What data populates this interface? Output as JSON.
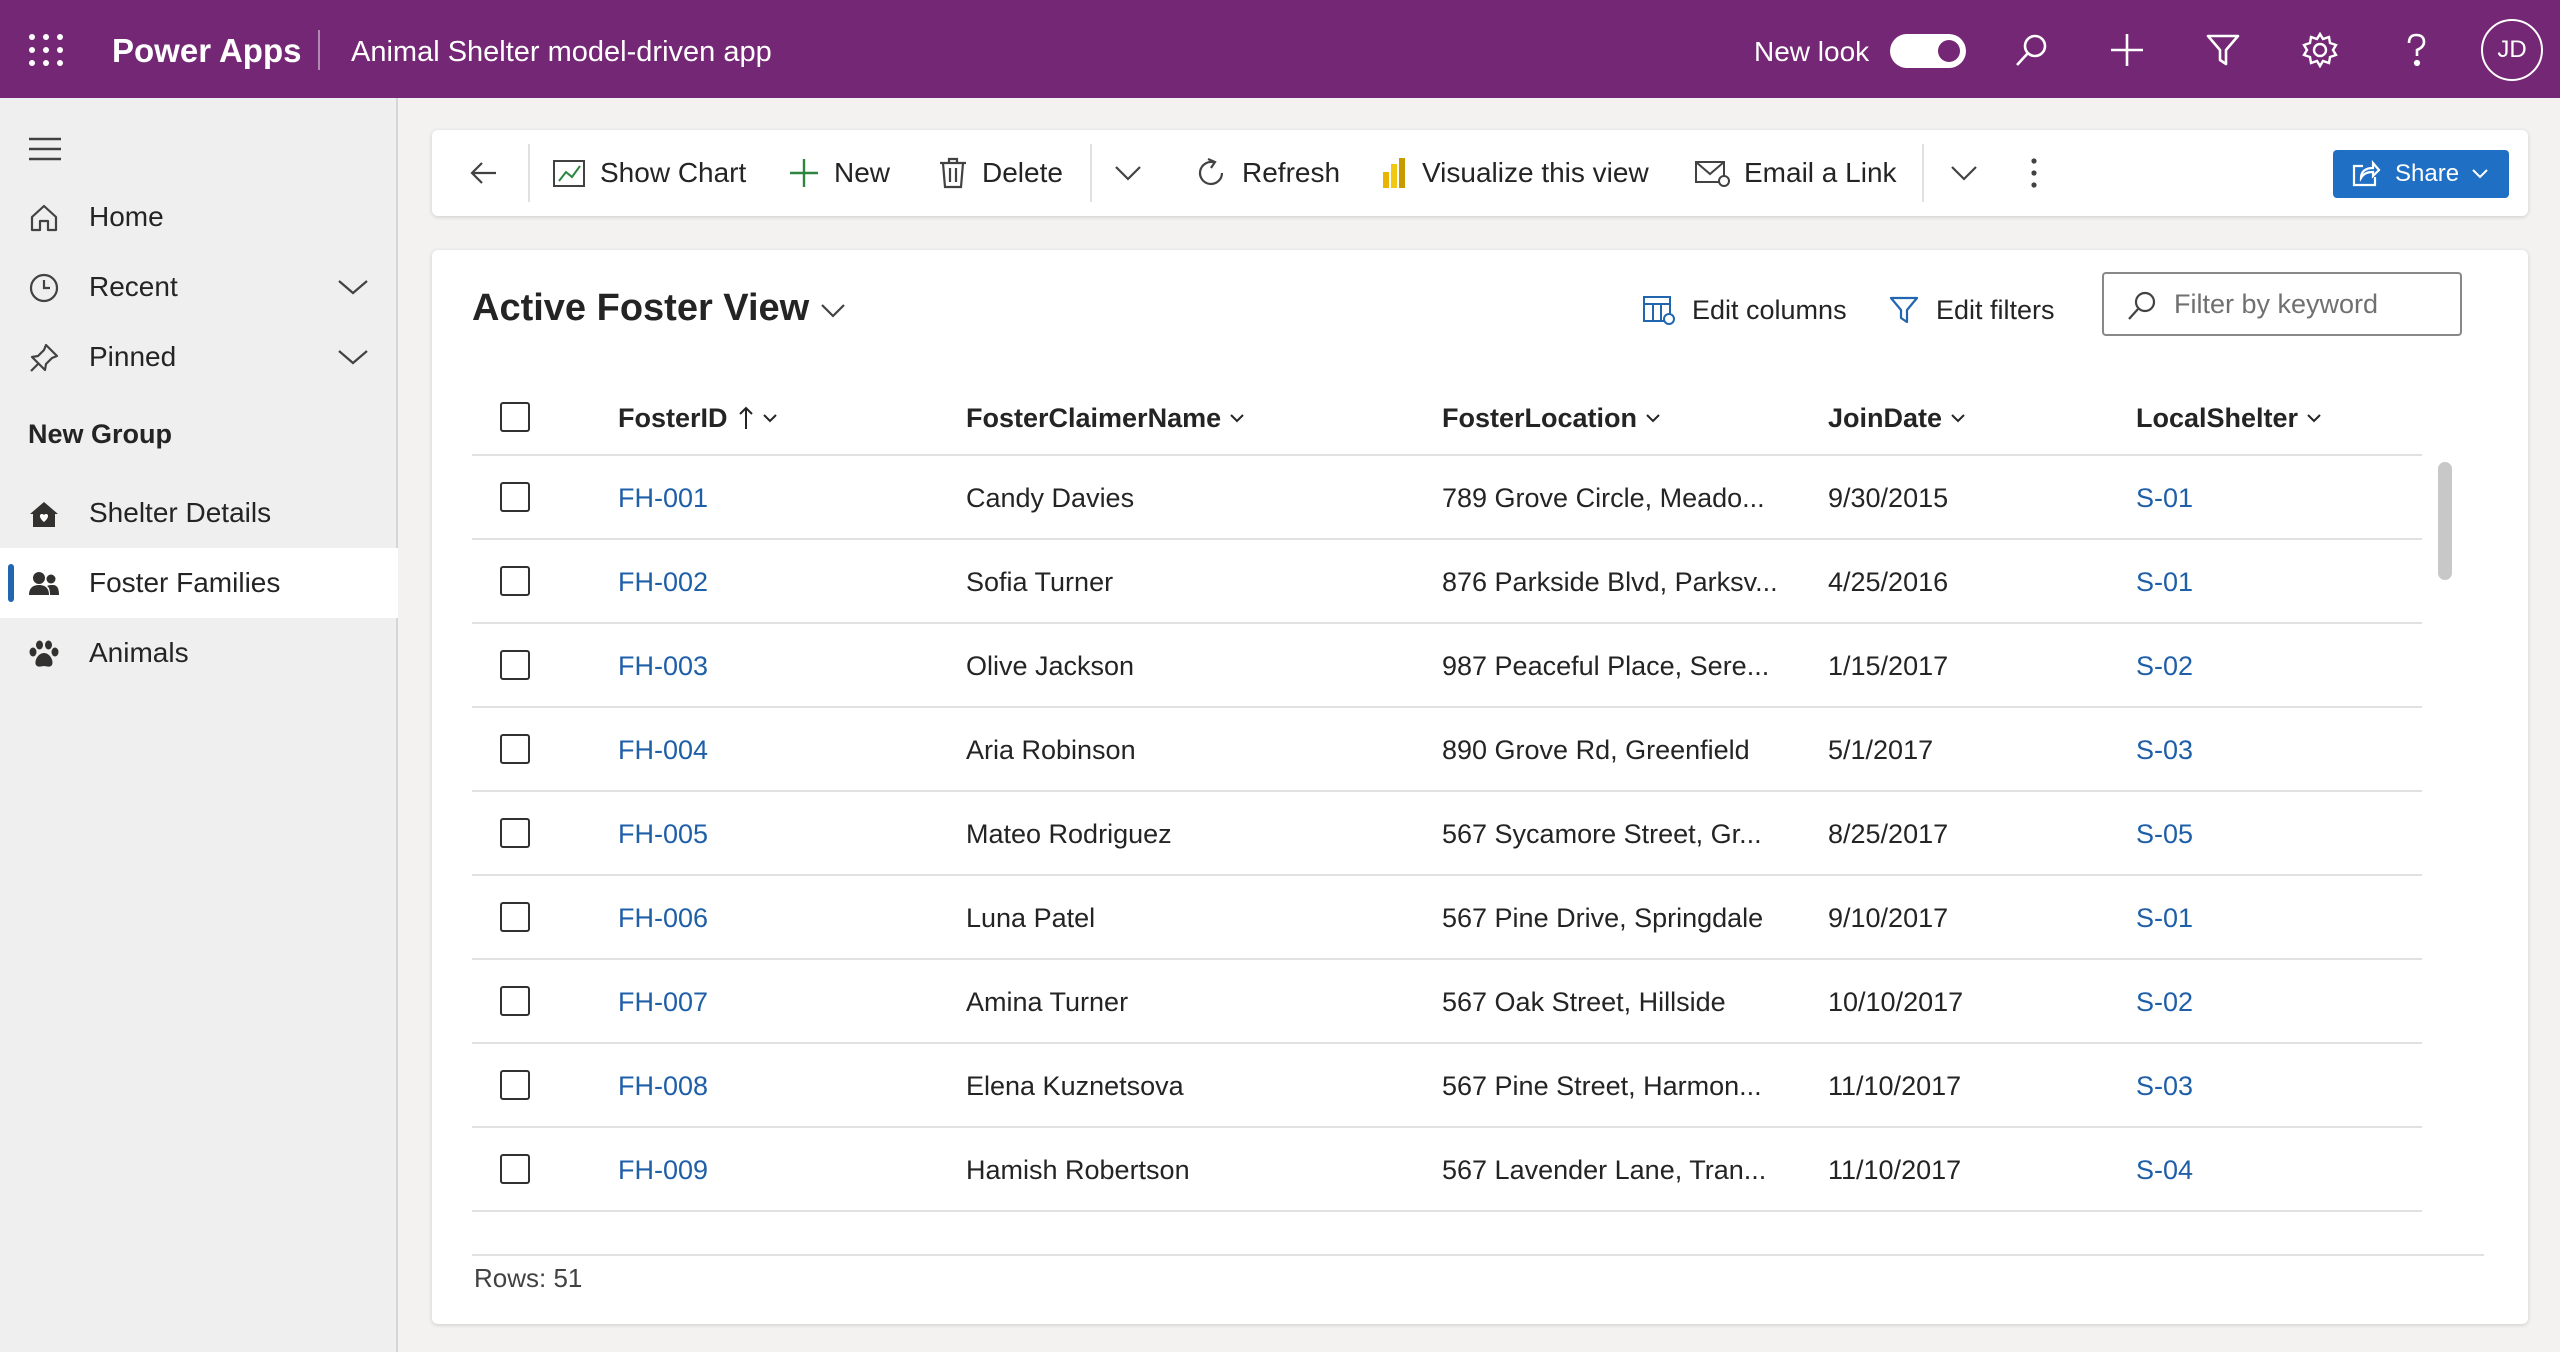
{
  "header": {
    "brand": "Power Apps",
    "app_name": "Animal Shelter model-driven app",
    "new_look_label": "New look",
    "new_look_enabled": true,
    "user_initials": "JD",
    "accent_color": "#742774"
  },
  "sidebar": {
    "items": [
      {
        "label": "Home",
        "icon": "home-icon"
      },
      {
        "label": "Recent",
        "icon": "clock-icon",
        "expandable": true
      },
      {
        "label": "Pinned",
        "icon": "pin-icon",
        "expandable": true
      }
    ],
    "group_label": "New Group",
    "group_items": [
      {
        "label": "Shelter Details",
        "icon": "house-icon",
        "active": false
      },
      {
        "label": "Foster Families",
        "icon": "people-icon",
        "active": true
      },
      {
        "label": "Animals",
        "icon": "paw-icon",
        "active": false
      }
    ]
  },
  "toolbar": {
    "show_chart": "Show Chart",
    "new": "New",
    "delete": "Delete",
    "refresh": "Refresh",
    "visualize": "Visualize this view",
    "email_link": "Email a Link",
    "share": "Share"
  },
  "view": {
    "title": "Active Foster View",
    "edit_columns": "Edit columns",
    "edit_filters": "Edit filters",
    "filter_placeholder": "Filter by keyword",
    "columns": [
      "FosterID",
      "FosterClaimerName",
      "FosterLocation",
      "JoinDate",
      "LocalShelter"
    ],
    "sorted_column": "FosterID",
    "rows": [
      [
        "FH-001",
        "Candy Davies",
        "789 Grove Circle, Meado...",
        "9/30/2015",
        "S-01"
      ],
      [
        "FH-002",
        "Sofia Turner",
        "876 Parkside Blvd, Parksv...",
        "4/25/2016",
        "S-01"
      ],
      [
        "FH-003",
        "Olive Jackson",
        "987 Peaceful Place, Sere...",
        "1/15/2017",
        "S-02"
      ],
      [
        "FH-004",
        "Aria Robinson",
        "890 Grove Rd, Greenfield",
        "5/1/2017",
        "S-03"
      ],
      [
        "FH-005",
        "Mateo Rodriguez",
        "567 Sycamore Street, Gr...",
        "8/25/2017",
        "S-05"
      ],
      [
        "FH-006",
        "Luna Patel",
        "567 Pine Drive, Springdale",
        "9/10/2017",
        "S-01"
      ],
      [
        "FH-007",
        "Amina Turner",
        "567 Oak Street, Hillside",
        "10/10/2017",
        "S-02"
      ],
      [
        "FH-008",
        "Elena Kuznetsova",
        "567 Pine Street, Harmon...",
        "11/10/2017",
        "S-03"
      ],
      [
        "FH-009",
        "Hamish Robertson",
        "567 Lavender Lane, Tran...",
        "11/10/2017",
        "S-04"
      ]
    ],
    "rows_count_label": "Rows: 51"
  }
}
